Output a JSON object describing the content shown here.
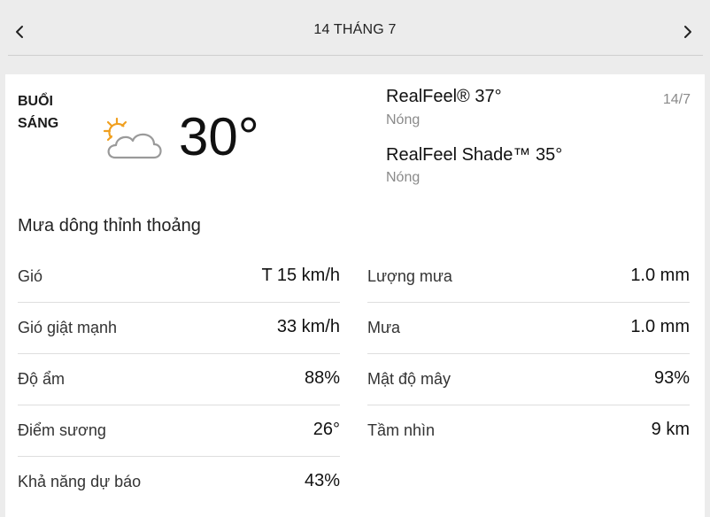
{
  "header": {
    "date_label": "14 THÁNG 7",
    "prev_icon": "chevron-left-icon",
    "next_icon": "chevron-right-icon"
  },
  "current": {
    "period": "BUỔI SÁNG",
    "icon": "partly-sunny-icon",
    "temperature": "30°",
    "realfeel": "RealFeel® 37°",
    "realfeel_desc": "Nóng",
    "realfeel_shade": "RealFeel Shade™ 35°",
    "realfeel_shade_desc": "Nóng",
    "date_badge": "14/7",
    "phrase": "Mưa dông thỉnh thoảng"
  },
  "details_left": [
    {
      "label": "Gió",
      "value": "T 15 km/h"
    },
    {
      "label": "Gió giật mạnh",
      "value": "33 km/h"
    },
    {
      "label": "Độ ẩm",
      "value": "88%"
    },
    {
      "label": "Điểm sương",
      "value": "26°"
    },
    {
      "label": "Khả năng dự báo",
      "value": "43%"
    }
  ],
  "details_right": [
    {
      "label": "Lượng mưa",
      "value": "1.0 mm"
    },
    {
      "label": "Mưa",
      "value": "1.0 mm"
    },
    {
      "label": "Mật độ mây",
      "value": "93%"
    },
    {
      "label": "Tầm nhìn",
      "value": "9 km"
    }
  ],
  "colors": {
    "background": "#ececec",
    "card": "#ffffff",
    "sun": "#f0a020",
    "cloud_stroke": "#9a9a9a",
    "muted_text": "#8a8a8a"
  }
}
